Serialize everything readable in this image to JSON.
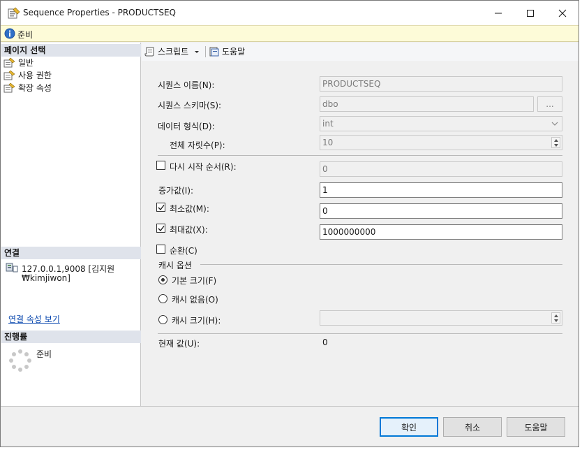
{
  "window": {
    "title": "Sequence Properties - PRODUCTSEQ",
    "status": "준비"
  },
  "left": {
    "page_select_header": "페이지 선택",
    "pages": [
      "일반",
      "사용 권한",
      "확장 속성"
    ],
    "connection_header": "연결",
    "connection_line1": "127.0.0.1,9008 [김지원",
    "connection_line2": "₩kimjiwon]",
    "connection_link": "연결 속성 보기",
    "progress_header": "진행률",
    "progress_status": "준비"
  },
  "toolbar": {
    "script_label": "스크립트",
    "help_label": "도움말"
  },
  "form": {
    "seq_name_label": "시퀀스 이름(N):",
    "seq_name_value": "PRODUCTSEQ",
    "schema_label": "시퀀스 스키마(S):",
    "schema_value": "dbo",
    "schema_browse": "...",
    "datatype_label": "데이터 형식(D):",
    "datatype_value": "int",
    "precision_label": "전체 자릿수(P):",
    "precision_value": "10",
    "restart_label": "다시 시작 순서(R):",
    "restart_value": "0",
    "restart_checked": false,
    "increment_label": "증가값(I):",
    "increment_value": "1",
    "min_label": "최소값(M):",
    "min_value": "0",
    "min_checked": true,
    "max_label": "최대값(X):",
    "max_value": "1000000000",
    "max_checked": true,
    "cycle_label": "순환(C)",
    "cycle_checked": false,
    "cache_group_label": "캐시 옵션",
    "cache_default_label": "기본 크기(F)",
    "cache_none_label": "캐시 없음(O)",
    "cache_size_label": "캐시 크기(H):",
    "cache_size_value": "",
    "cache_selected": "default",
    "current_label": "현재 값(U):",
    "current_value": "0"
  },
  "footer": {
    "ok_label": "확인",
    "cancel_label": "취소",
    "help_label": "도움말"
  },
  "colors": {
    "status_bg": "#fdfbd8",
    "section_header_bg": "#dfe3eb",
    "default_button_border": "#0078d7",
    "link": "#0645ad"
  }
}
